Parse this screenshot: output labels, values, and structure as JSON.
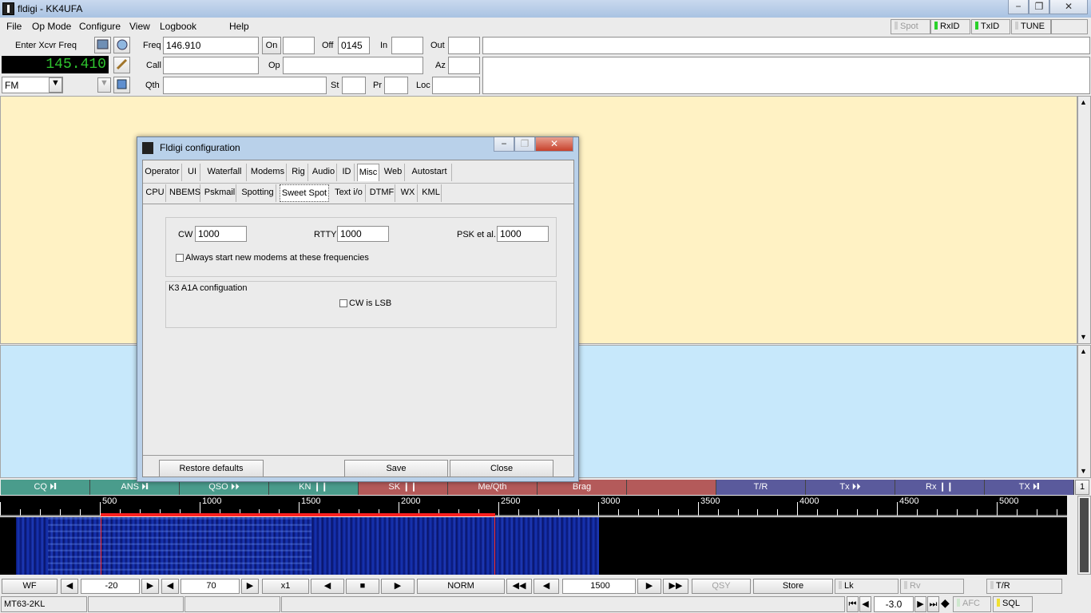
{
  "window": {
    "title": "fldigi - KK4UFA",
    "minimize": "−",
    "restore": "❐",
    "close": "✕"
  },
  "menu": {
    "file": "File",
    "op_mode": "Op Mode",
    "configure": "Configure",
    "view": "View",
    "logbook": "Logbook",
    "help": "Help"
  },
  "toggles": {
    "spot": "Spot",
    "rxid": "RxID",
    "txid": "TxID",
    "tune": "TUNE"
  },
  "log": {
    "enter_xcvr": "Enter Xcvr Freq",
    "freq_display": "145.410",
    "mode": "FM",
    "freq_label": "Freq",
    "freq_value": "146.910",
    "on_label": "On",
    "off_label": "Off",
    "off_value": "0145",
    "in_label": "In",
    "out_label": "Out",
    "call_label": "Call",
    "op_label": "Op",
    "az_label": "Az",
    "qth_label": "Qth",
    "st_label": "St",
    "pr_label": "Pr",
    "loc_label": "Loc"
  },
  "macros": [
    {
      "label": "CQ ⏵❙",
      "color": "#4a9c8c"
    },
    {
      "label": "ANS ⏵❙",
      "color": "#4a9c8c"
    },
    {
      "label": "QSO ⏵⏵",
      "color": "#4a9c8c"
    },
    {
      "label": "KN ❙❙",
      "color": "#4a9c8c"
    },
    {
      "label": "SK ❙❙",
      "color": "#b45a5a"
    },
    {
      "label": "Me/Qth",
      "color": "#b45a5a"
    },
    {
      "label": "Brag",
      "color": "#b45a5a"
    },
    {
      "label": "",
      "color": "#b45a5a"
    },
    {
      "label": "T/R",
      "color": "#5a5a9c"
    },
    {
      "label": "Tx ⏵⏵",
      "color": "#5a5a9c"
    },
    {
      "label": "Rx ❙❙",
      "color": "#5a5a9c"
    },
    {
      "label": "TX ⏵❙",
      "color": "#5a5a9c"
    }
  ],
  "macro_page": "1",
  "ruler_ticks": [
    "500",
    "1000",
    "1500",
    "2000",
    "2500",
    "3000",
    "3500",
    "4000",
    "4500",
    "5000"
  ],
  "controls": {
    "wf": "WF",
    "ref_level": "-20",
    "range": "70",
    "zoom": "x1",
    "norm": "NORM",
    "carrier": "1500",
    "qsy": "QSY",
    "store": "Store",
    "lk": "Lk",
    "rv": "Rv",
    "tr": "T/R"
  },
  "status": {
    "mode": "MT63-2KL",
    "level": "-3.0",
    "afc": "AFC",
    "sql": "SQL"
  },
  "dialog": {
    "title": "Fldigi configuration",
    "tabs": [
      "Operator",
      "UI",
      "Waterfall",
      "Modems",
      "Rig",
      "Audio",
      "ID",
      "Misc",
      "Web",
      "Autostart"
    ],
    "active_tab": "Misc",
    "subtabs": [
      "CPU",
      "NBEMS",
      "Pskmail",
      "Spotting",
      "Sweet Spot",
      "Text i/o",
      "DTMF",
      "WX",
      "KML"
    ],
    "active_subtab": "Sweet Spot",
    "cw_label": "CW",
    "cw_value": "1000",
    "rtty_label": "RTTY",
    "rtty_value": "1000",
    "psk_label": "PSK et al.",
    "psk_value": "1000",
    "always_start": "Always start new modems at these frequencies",
    "k3_group": "K3 A1A configuation",
    "cw_lsb": "CW is LSB",
    "restore_btn": "Restore defaults",
    "save_btn": "Save",
    "close_btn": "Close"
  }
}
